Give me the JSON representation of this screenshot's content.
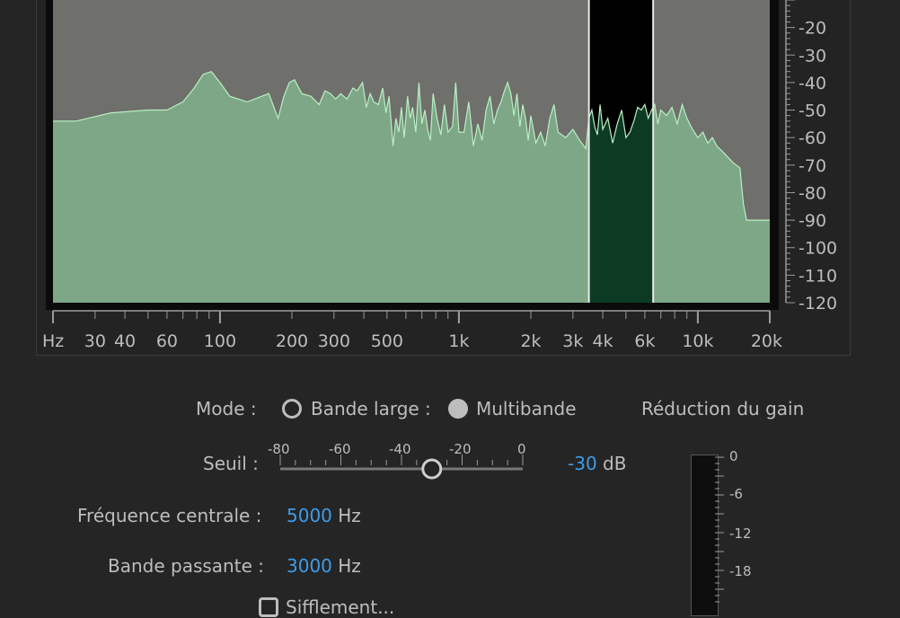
{
  "spectrum": {
    "db_labels": [
      "-20",
      "-30",
      "-40",
      "-50",
      "-60",
      "-70",
      "-80",
      "-90",
      "-100",
      "-110",
      "-120"
    ],
    "freq_labels": [
      {
        "f": 20,
        "t": "Hz",
        "major": true
      },
      {
        "f": 30,
        "t": "30",
        "major": false
      },
      {
        "f": 40,
        "t": "40",
        "major": false
      },
      {
        "f": 60,
        "t": "60",
        "major": false
      },
      {
        "f": 100,
        "t": "100",
        "major": true
      },
      {
        "f": 200,
        "t": "200",
        "major": false
      },
      {
        "f": 300,
        "t": "300",
        "major": false
      },
      {
        "f": 500,
        "t": "500",
        "major": false
      },
      {
        "f": 1000,
        "t": "1k",
        "major": true
      },
      {
        "f": 2000,
        "t": "2k",
        "major": false
      },
      {
        "f": 3000,
        "t": "3k",
        "major": false
      },
      {
        "f": 4000,
        "t": "4k",
        "major": false
      },
      {
        "f": 6000,
        "t": "6k",
        "major": false
      },
      {
        "f": 10000,
        "t": "10k",
        "major": true
      },
      {
        "f": 20000,
        "t": "20k",
        "major": true
      }
    ],
    "band_low_hz": 3500,
    "band_high_hz": 6500,
    "curve_db": [
      [
        20,
        -54
      ],
      [
        25,
        -54
      ],
      [
        35,
        -51
      ],
      [
        50,
        -50
      ],
      [
        60,
        -50
      ],
      [
        70,
        -47
      ],
      [
        78,
        -42
      ],
      [
        85,
        -37
      ],
      [
        92,
        -36
      ],
      [
        100,
        -40
      ],
      [
        110,
        -45
      ],
      [
        130,
        -47
      ],
      [
        160,
        -44
      ],
      [
        175,
        -53
      ],
      [
        185,
        -45
      ],
      [
        195,
        -40
      ],
      [
        205,
        -39
      ],
      [
        220,
        -44
      ],
      [
        240,
        -45
      ],
      [
        260,
        -48
      ],
      [
        275,
        -43
      ],
      [
        290,
        -44
      ],
      [
        305,
        -46
      ],
      [
        320,
        -44
      ],
      [
        340,
        -46
      ],
      [
        360,
        -42
      ],
      [
        375,
        -43
      ],
      [
        395,
        -40
      ],
      [
        410,
        -49
      ],
      [
        425,
        -44
      ],
      [
        440,
        -47
      ],
      [
        460,
        -48
      ],
      [
        480,
        -42
      ],
      [
        495,
        -51
      ],
      [
        510,
        -45
      ],
      [
        530,
        -63
      ],
      [
        545,
        -53
      ],
      [
        560,
        -58
      ],
      [
        575,
        -49
      ],
      [
        590,
        -60
      ],
      [
        610,
        -45
      ],
      [
        625,
        -53
      ],
      [
        640,
        -49
      ],
      [
        660,
        -58
      ],
      [
        680,
        -40
      ],
      [
        700,
        -55
      ],
      [
        720,
        -50
      ],
      [
        740,
        -57
      ],
      [
        760,
        -61
      ],
      [
        780,
        -44
      ],
      [
        810,
        -53
      ],
      [
        840,
        -59
      ],
      [
        870,
        -48
      ],
      [
        900,
        -58
      ],
      [
        940,
        -56
      ],
      [
        970,
        -40
      ],
      [
        1000,
        -58
      ],
      [
        1050,
        -58
      ],
      [
        1100,
        -47
      ],
      [
        1150,
        -63
      ],
      [
        1200,
        -55
      ],
      [
        1250,
        -61
      ],
      [
        1300,
        -50
      ],
      [
        1350,
        -45
      ],
      [
        1400,
        -55
      ],
      [
        1450,
        -50
      ],
      [
        1500,
        -47
      ],
      [
        1550,
        -43
      ],
      [
        1600,
        -40
      ],
      [
        1650,
        -44
      ],
      [
        1700,
        -52
      ],
      [
        1750,
        -44
      ],
      [
        1800,
        -56
      ],
      [
        1850,
        -48
      ],
      [
        1900,
        -53
      ],
      [
        1950,
        -61
      ],
      [
        2000,
        -52
      ],
      [
        2100,
        -62
      ],
      [
        2200,
        -58
      ],
      [
        2300,
        -63
      ],
      [
        2400,
        -53
      ],
      [
        2500,
        -48
      ],
      [
        2600,
        -58
      ],
      [
        2800,
        -60
      ],
      [
        3000,
        -57
      ],
      [
        3200,
        -61
      ],
      [
        3400,
        -64
      ],
      [
        3500,
        -53
      ],
      [
        3600,
        -50
      ],
      [
        3700,
        -56
      ],
      [
        3800,
        -59
      ],
      [
        3900,
        -48
      ],
      [
        4000,
        -57
      ],
      [
        4200,
        -53
      ],
      [
        4400,
        -62
      ],
      [
        4600,
        -55
      ],
      [
        4800,
        -50
      ],
      [
        5000,
        -60
      ],
      [
        5200,
        -58
      ],
      [
        5400,
        -54
      ],
      [
        5600,
        -49
      ],
      [
        5800,
        -50
      ],
      [
        6000,
        -48
      ],
      [
        6200,
        -53
      ],
      [
        6400,
        -50
      ],
      [
        6600,
        -48
      ],
      [
        6800,
        -55
      ],
      [
        7000,
        -50
      ],
      [
        7400,
        -52
      ],
      [
        7800,
        -49
      ],
      [
        8200,
        -55
      ],
      [
        8600,
        -48
      ],
      [
        9000,
        -53
      ],
      [
        9500,
        -57
      ],
      [
        10000,
        -60
      ],
      [
        10500,
        -58
      ],
      [
        11000,
        -62
      ],
      [
        11500,
        -60
      ],
      [
        12000,
        -63
      ],
      [
        13000,
        -66
      ],
      [
        14000,
        -69
      ],
      [
        15000,
        -71
      ],
      [
        15500,
        -84
      ],
      [
        16000,
        -90
      ],
      [
        18000,
        -90
      ],
      [
        20000,
        -90
      ]
    ]
  },
  "controls": {
    "mode_label": "Mode :",
    "mode_broadband": "Bande large :",
    "mode_multiband": "Multibande",
    "gain_reduction_label": "Réduction du gain",
    "threshold_label": "Seuil :",
    "threshold_ticks": [
      "-80",
      "-60",
      "-40",
      "-20",
      "0"
    ],
    "threshold_value": "-30",
    "threshold_unit": "dB",
    "threshold_db": -30,
    "center_freq_label": "Fréquence centrale :",
    "center_freq_value": "5000",
    "center_freq_unit": "Hz",
    "bandwidth_label": "Bande passante :",
    "bandwidth_value": "3000",
    "bandwidth_unit": "Hz",
    "meter_labels": [
      "0",
      "-6",
      "-12",
      "-18"
    ],
    "checkbox_label": "Sifflement..."
  },
  "colors": {
    "accent": "#3d9ce8",
    "spectrum_fill": "#7ea787",
    "spectrum_line": "#b8f0c4",
    "band_fill": "#0d3a22",
    "background": "#252525"
  }
}
